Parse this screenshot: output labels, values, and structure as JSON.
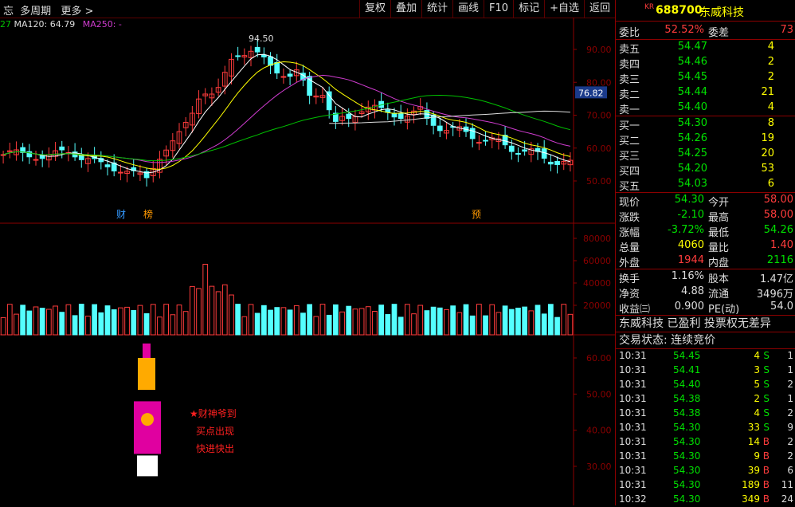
{
  "topbar": {
    "left_items": [
      "多周期",
      "更多 >"
    ],
    "left_stub": "忘",
    "buttons": [
      "复权",
      "叠加",
      "统计",
      "画线",
      "F10",
      "标记",
      "+自选",
      "返回"
    ]
  },
  "legend": {
    "prefix": "27",
    "ma120": "MA120: 64.79",
    "ma250": "MA250: -"
  },
  "price_axis": {
    "ticks": [
      "90.00",
      "80.00",
      "70.00",
      "60.00",
      "50.00"
    ],
    "current_label": "76.82",
    "peak_label": "94.50"
  },
  "volume_axis": {
    "ticks": [
      "80000",
      "60000",
      "40000",
      "20000"
    ]
  },
  "indicator_axis": {
    "ticks": [
      "60.00",
      "50.00",
      "40.00",
      "30.00"
    ]
  },
  "event_markers": [
    {
      "label": "财",
      "color": "#3399ff"
    },
    {
      "label": "榜",
      "color": "#ff9900"
    },
    {
      "label": "预",
      "color": "#ff9900"
    }
  ],
  "annotation": {
    "line1": "★财神爷到",
    "line2": "买点出现",
    "line3": "快进快出"
  },
  "stock": {
    "kr": "KR",
    "code": "688700",
    "name": "东威科技"
  },
  "weibi": {
    "label1": "委比",
    "val1": "52.52%",
    "label2": "委差",
    "val2": "73"
  },
  "asks": [
    {
      "label": "卖五",
      "price": "54.47",
      "vol": "4"
    },
    {
      "label": "卖四",
      "price": "54.46",
      "vol": "2"
    },
    {
      "label": "卖三",
      "price": "54.45",
      "vol": "2"
    },
    {
      "label": "卖二",
      "price": "54.44",
      "vol": "21"
    },
    {
      "label": "卖一",
      "price": "54.40",
      "vol": "4"
    }
  ],
  "bids": [
    {
      "label": "买一",
      "price": "54.30",
      "vol": "8"
    },
    {
      "label": "买二",
      "price": "54.26",
      "vol": "19"
    },
    {
      "label": "买三",
      "price": "54.25",
      "vol": "20"
    },
    {
      "label": "买四",
      "price": "54.20",
      "vol": "53"
    },
    {
      "label": "买五",
      "price": "54.03",
      "vol": "6"
    }
  ],
  "quote": [
    {
      "l1": "现价",
      "v1": "54.30",
      "c1": "g",
      "l2": "今开",
      "v2": "58.00",
      "c2": "r"
    },
    {
      "l1": "涨跌",
      "v1": "-2.10",
      "c1": "g",
      "l2": "最高",
      "v2": "58.00",
      "c2": "r"
    },
    {
      "l1": "涨幅",
      "v1": "-3.72%",
      "c1": "g",
      "l2": "最低",
      "v2": "54.26",
      "c2": "g"
    },
    {
      "l1": "总量",
      "v1": "4060",
      "c1": "y",
      "l2": "量比",
      "v2": "1.40",
      "c2": "r"
    },
    {
      "l1": "外盘",
      "v1": "1944",
      "c1": "r",
      "l2": "内盘",
      "v2": "2116",
      "c2": "g"
    }
  ],
  "fundamentals": [
    {
      "l1": "换手",
      "v1": "1.16%",
      "l2": "股本",
      "v2": "1.47亿"
    },
    {
      "l1": "净资",
      "v1": "4.88",
      "l2": "流通",
      "v2": "3496万"
    },
    {
      "l1": "收益㈢",
      "v1": "0.900",
      "l2": "PE(动)",
      "v2": "54.0"
    }
  ],
  "info_line1": "东威科技 已盈利 投票权无差异",
  "info_line2": "交易状态: 连续竞价",
  "ticks": [
    {
      "t": "10:31",
      "p": "54.45",
      "v": "4",
      "s": "S",
      "n": "1"
    },
    {
      "t": "10:31",
      "p": "54.41",
      "v": "3",
      "s": "S",
      "n": "1"
    },
    {
      "t": "10:31",
      "p": "54.40",
      "v": "5",
      "s": "S",
      "n": "2"
    },
    {
      "t": "10:31",
      "p": "54.38",
      "v": "2",
      "s": "S",
      "n": "1"
    },
    {
      "t": "10:31",
      "p": "54.38",
      "v": "4",
      "s": "S",
      "n": "2"
    },
    {
      "t": "10:31",
      "p": "54.30",
      "v": "33",
      "s": "S",
      "n": "9"
    },
    {
      "t": "10:31",
      "p": "54.30",
      "v": "14",
      "s": "B",
      "n": "2"
    },
    {
      "t": "10:31",
      "p": "54.30",
      "v": "9",
      "s": "B",
      "n": "2"
    },
    {
      "t": "10:31",
      "p": "54.30",
      "v": "39",
      "s": "B",
      "n": "6"
    },
    {
      "t": "10:31",
      "p": "54.30",
      "v": "189",
      "s": "B",
      "n": "11"
    },
    {
      "t": "10:32",
      "p": "54.30",
      "v": "349",
      "s": "B",
      "n": "24"
    }
  ],
  "colors": {
    "up": "#ff3c3c",
    "down": "#54ffff",
    "ma5": "#ffffff",
    "ma10": "#ffff00",
    "ma20": "#d03cd0",
    "ma60": "#00c000",
    "grid": "#8b0000"
  }
}
